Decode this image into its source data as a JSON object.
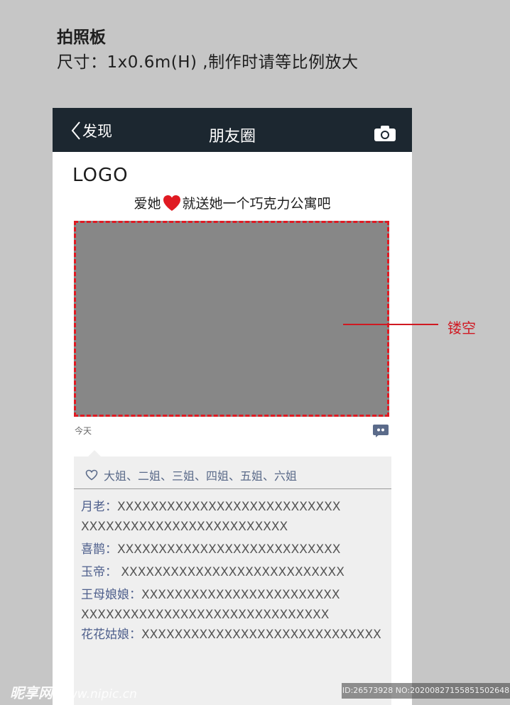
{
  "header": {
    "title": "拍照板",
    "subtitle": "尺寸：1x0.6m(H) ,制作时请等比例放大"
  },
  "navbar": {
    "back_label": "发现",
    "title": "朋友圈"
  },
  "post": {
    "logo": "LOGO",
    "slogan_before": "爱她",
    "slogan_after": "就送她一个巧克力公寓吧",
    "time": "今天"
  },
  "comments": {
    "likes": "大姐、二姐、三姐、四姐、五姐、六姐",
    "items": [
      {
        "name": "月老：",
        "text": "XXXXXXXXXXXXXXXXXXXXXXXXXXX",
        "cont": "XXXXXXXXXXXXXXXXXXXXXXXXX"
      },
      {
        "name": "喜鹊：",
        "text": "XXXXXXXXXXXXXXXXXXXXXXXXXXX"
      },
      {
        "name": "玉帝：",
        "text": " XXXXXXXXXXXXXXXXXXXXXXXXXXX"
      },
      {
        "name": "王母娘娘：",
        "text": "XXXXXXXXXXXXXXXXXXXXXXXX",
        "cont": "XXXXXXXXXXXXXXXXXXXXXXXXXXXXXX"
      },
      {
        "name": "花花姑娘：",
        "text": "XXXXXXXXXXXXXXXXXXXXXXXXXXXXX"
      }
    ]
  },
  "annotation": {
    "label": "镂空"
  },
  "watermark": {
    "left_brand": "昵享网",
    "left_site": "www.nipic.cn",
    "right": "ID:26573928 NO:20200827155851502648"
  },
  "colors": {
    "background": "#c6c6c6",
    "navbar": "#1c2730",
    "photo_area": "#878787",
    "accent_red": "#e01a22",
    "comment_bg": "#efefef",
    "comment_name": "#4e5f8c"
  },
  "icons": [
    "chevron-left-icon",
    "camera-icon",
    "heart-icon",
    "comment-icon",
    "heart-outline-icon"
  ]
}
